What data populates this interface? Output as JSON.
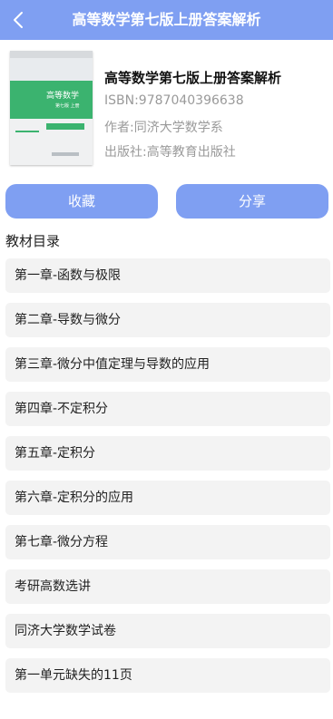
{
  "header": {
    "title": "高等数学第七版上册答案解析",
    "back_icon": "chevron-left-icon"
  },
  "book": {
    "title": "高等数学第七版上册答案解析",
    "isbn": "ISBN:9787040396638",
    "author": "作者:同济大学数学系",
    "publisher": "出版社:高等教育出版社",
    "cover": {
      "title": "高等数学",
      "subtitle": "第七版 上册"
    }
  },
  "actions": {
    "favorite_label": "收藏",
    "share_label": "分享"
  },
  "catalog": {
    "title": "教材目录",
    "items": [
      "第一章-函数与极限",
      "第二章-导数与微分",
      "第三章-微分中值定理与导数的应用",
      "第四章-不定积分",
      "第五章-定积分",
      "第六章-定积分的应用",
      "第七章-微分方程",
      "考研高数选讲",
      "同济大学数学试卷",
      "第一单元缺失的11页"
    ]
  },
  "colors": {
    "accent": "#7f9ff2",
    "list_bg": "#f3f3f3",
    "cover_green": "#3bb36f"
  }
}
